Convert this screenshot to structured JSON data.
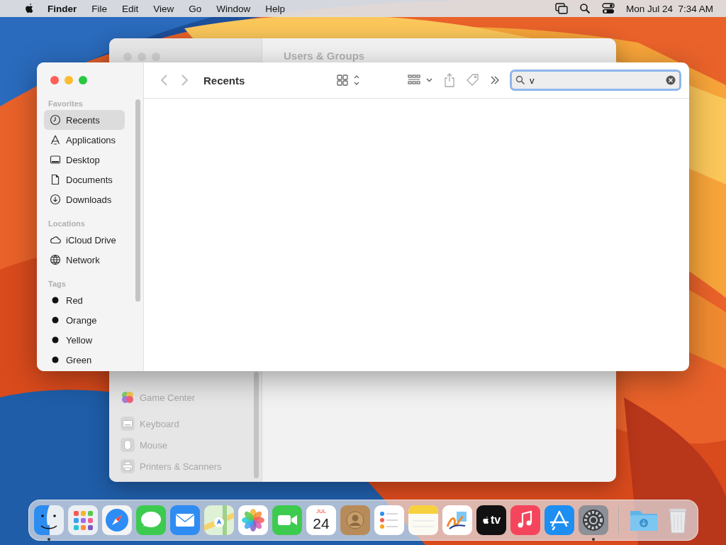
{
  "menubar": {
    "menus": [
      {
        "label": "Finder",
        "kind": "app"
      },
      {
        "label": "File",
        "kind": "menu"
      },
      {
        "label": "Edit",
        "kind": "menu"
      },
      {
        "label": "View",
        "kind": "menu"
      },
      {
        "label": "Go",
        "kind": "menu"
      },
      {
        "label": "Window",
        "kind": "menu"
      },
      {
        "label": "Help",
        "kind": "menu"
      }
    ],
    "clock": "Mon Jul 24  7:34 AM"
  },
  "back_window": {
    "title": "Users & Groups",
    "sidebar_groups": [
      [
        {
          "label": "Game Center",
          "kind": "game"
        }
      ],
      [
        {
          "label": "Keyboard",
          "kind": "keyboard"
        },
        {
          "label": "Mouse",
          "kind": "mouse"
        },
        {
          "label": "Printers & Scanners",
          "kind": "printer"
        }
      ]
    ]
  },
  "finder": {
    "title": "Recents",
    "search": {
      "value": "v"
    },
    "sidebar": [
      {
        "heading": "Favorites",
        "items": [
          {
            "label": "Recents",
            "kind": "clock",
            "selected": true
          },
          {
            "label": "Applications",
            "kind": "apps",
            "selected": false
          },
          {
            "label": "Desktop",
            "kind": "desktop",
            "selected": false
          },
          {
            "label": "Documents",
            "kind": "document",
            "selected": false
          },
          {
            "label": "Downloads",
            "kind": "download",
            "selected": false
          }
        ]
      },
      {
        "heading": "Locations",
        "items": [
          {
            "label": "iCloud Drive",
            "kind": "cloud",
            "selected": false
          },
          {
            "label": "Network",
            "kind": "globe",
            "selected": false
          }
        ]
      },
      {
        "heading": "Tags",
        "items": [
          {
            "label": "Red",
            "kind": "tag",
            "selected": false
          },
          {
            "label": "Orange",
            "kind": "tag",
            "selected": false
          },
          {
            "label": "Yellow",
            "kind": "tag",
            "selected": false
          },
          {
            "label": "Green",
            "kind": "tag",
            "selected": false
          }
        ]
      }
    ]
  },
  "dock": [
    {
      "kind": "finder",
      "running": true
    },
    {
      "kind": "launchpad",
      "running": false
    },
    {
      "kind": "safari",
      "running": false
    },
    {
      "kind": "messages",
      "running": false
    },
    {
      "kind": "mail",
      "running": false
    },
    {
      "kind": "maps",
      "running": false
    },
    {
      "kind": "photos",
      "running": false
    },
    {
      "kind": "facetime",
      "running": false
    },
    {
      "kind": "calendar",
      "running": false,
      "month": "JUL",
      "day": "24"
    },
    {
      "kind": "contacts",
      "running": false
    },
    {
      "kind": "reminders",
      "running": false
    },
    {
      "kind": "notes",
      "running": false
    },
    {
      "kind": "freeform",
      "running": false
    },
    {
      "kind": "tv",
      "running": false,
      "label": "tv"
    },
    {
      "kind": "music",
      "running": false
    },
    {
      "kind": "appstore",
      "running": false
    },
    {
      "kind": "settings",
      "running": true
    },
    {
      "kind": "separator"
    },
    {
      "kind": "downloads",
      "running": false
    },
    {
      "kind": "trash",
      "running": false
    }
  ]
}
